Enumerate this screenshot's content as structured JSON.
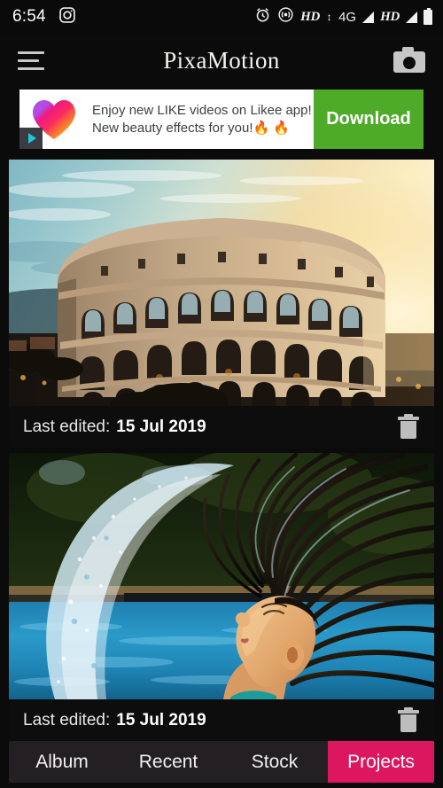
{
  "status_bar": {
    "time": "6:54",
    "icons": {
      "instagram": "instagram-icon",
      "alarm": "alarm-icon",
      "hotspot": "hotspot-icon",
      "battery": "battery-icon"
    },
    "hd_label_1": "HD",
    "network": "4G",
    "hd_label_2": "HD"
  },
  "app_bar": {
    "menu_icon": "hamburger-menu-icon",
    "title": "PixaMotion",
    "camera_icon": "camera-icon"
  },
  "ad": {
    "line1": "Enjoy new LIKE videos on Likee app!",
    "line2": "New beauty effects for you!🔥 🔥",
    "cta_label": "Download",
    "logo": "likee-heart-logo",
    "adchoices_icon": "adchoices-play-icon",
    "cta_color": "#4eab27"
  },
  "projects": {
    "label_prefix": "Last edited:",
    "items": [
      {
        "thumb": "colosseum-sunset-photo",
        "last_edited_label": "Last edited:",
        "date": "15 Jul 2019",
        "delete_icon": "trash-icon"
      },
      {
        "thumb": "woman-hair-flip-pool-photo",
        "last_edited_label": "Last edited:",
        "date": "15 Jul 2019",
        "delete_icon": "trash-icon"
      }
    ]
  },
  "bottom_nav": {
    "active_color": "#dd1660",
    "tabs": [
      {
        "label": "Album",
        "active": false
      },
      {
        "label": "Recent",
        "active": false
      },
      {
        "label": "Stock",
        "active": false
      },
      {
        "label": "Projects",
        "active": true
      }
    ]
  }
}
